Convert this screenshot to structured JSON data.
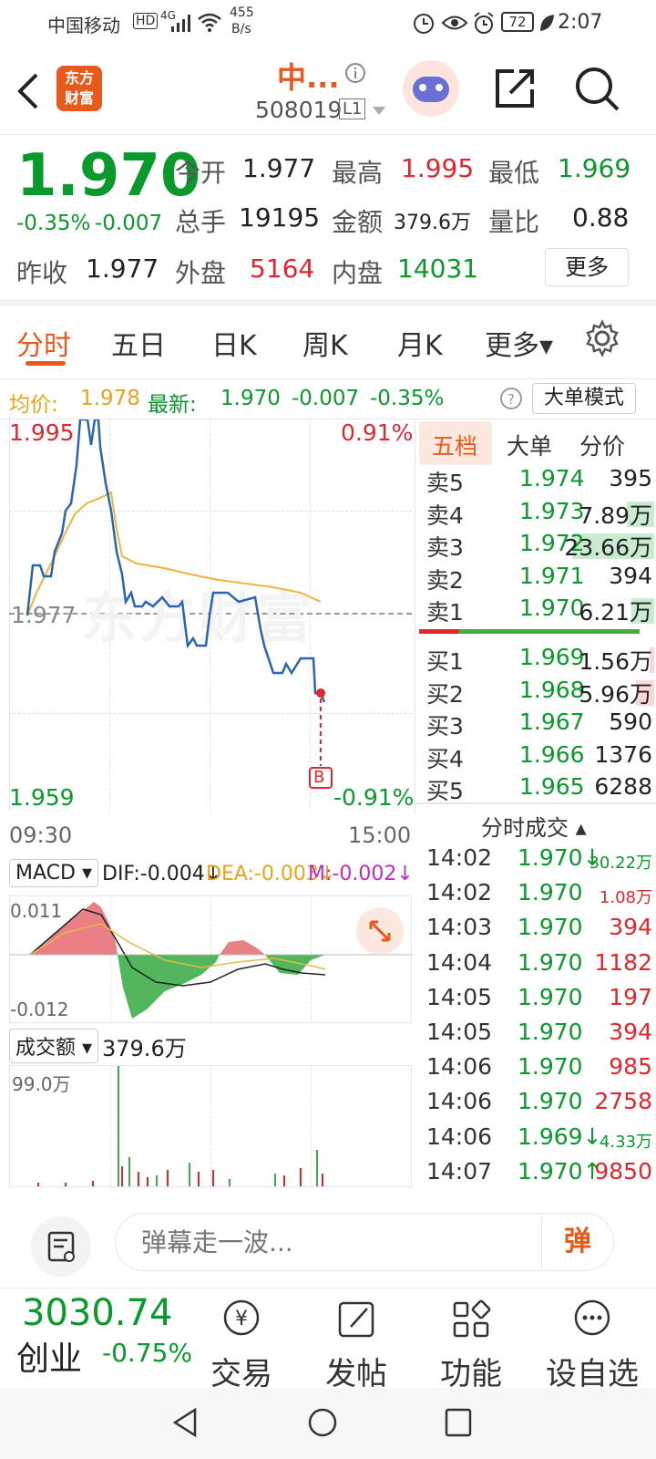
{
  "status_bar": {
    "carrier": "中国移动",
    "hd": "HD",
    "signal": "4G",
    "speed_value": "455",
    "speed_unit": "B/s",
    "battery": "72",
    "time": "2:07"
  },
  "header": {
    "stock_name": "中...",
    "stock_code": "508019",
    "level": "L1"
  },
  "quote": {
    "price": "1.970",
    "change_pct": "-0.35%",
    "change": "-0.007",
    "open_label": "今开",
    "open": "1.977",
    "high_label": "最高",
    "high": "1.995",
    "low_label": "最低",
    "low": "1.969",
    "volume_label": "总手",
    "volume": "19195",
    "amount_label": "金额",
    "amount": "379.6万",
    "ratio_label": "量比",
    "ratio": "0.88",
    "prev_close_label": "昨收",
    "prev_close": "1.977",
    "outer_label": "外盘",
    "outer": "5164",
    "inner_label": "内盘",
    "inner": "14031",
    "more_label": "更多"
  },
  "tabs": [
    {
      "label": "分时"
    },
    {
      "label": "五日"
    },
    {
      "label": "日K"
    },
    {
      "label": "周K"
    },
    {
      "label": "月K"
    },
    {
      "label": "更多▾"
    }
  ],
  "avg_line": {
    "avg_label": "均价:",
    "avg_value": "1.978",
    "latest_label": "最新:",
    "latest": "1.970",
    "change": "-0.007",
    "pct": "-0.35%",
    "big_order_label": "大单模式"
  },
  "chart": {
    "y_top": "1.995",
    "y_mid": "1.977",
    "y_bottom": "1.959",
    "pct_top": "0.91%",
    "pct_bottom": "-0.91%",
    "x_start": "09:30",
    "x_end": "15:00",
    "watermark": "东方财富",
    "marker": "B"
  },
  "macd": {
    "label": "MACD ▾",
    "dif": "DIF:-0.004↓",
    "dea": "DEA:-0.003↓",
    "m": "M:-0.002↓",
    "y_top": "0.011",
    "y_bottom": "-0.012"
  },
  "volume_panel": {
    "label": "成交额 ▾",
    "value": "379.6万",
    "y_top": "99.0万"
  },
  "orderbook": {
    "tabs": [
      "五档",
      "大单",
      "分价"
    ],
    "asks": [
      {
        "label": "卖5",
        "price": "1.974",
        "vol": "395",
        "bar": 0.0
      },
      {
        "label": "卖4",
        "price": "1.973",
        "vol": "7.89万",
        "bar": 0.12
      },
      {
        "label": "卖3",
        "price": "1.972",
        "vol": "23.66万",
        "bar": 0.36
      },
      {
        "label": "卖2",
        "price": "1.971",
        "vol": "394",
        "bar": 0.0
      },
      {
        "label": "卖1",
        "price": "1.970",
        "vol": "6.21万",
        "bar": 0.1
      }
    ],
    "bids": [
      {
        "label": "买1",
        "price": "1.969",
        "vol": "1.56万",
        "bar": 0.02
      },
      {
        "label": "买2",
        "price": "1.968",
        "vol": "5.96万",
        "bar": 0.08
      },
      {
        "label": "买3",
        "price": "1.967",
        "vol": "590",
        "bar": 0.0
      },
      {
        "label": "买4",
        "price": "1.966",
        "vol": "1376",
        "bar": 0.0
      },
      {
        "label": "买5",
        "price": "1.965",
        "vol": "6288",
        "bar": 0.0
      }
    ],
    "trades_title": "分时成交 ▴",
    "trades": [
      {
        "time": "14:02",
        "price": "1.970↓",
        "vol": "30.22万",
        "dir": "g",
        "small": true
      },
      {
        "time": "14:02",
        "price": "1.970",
        "vol": "1.08万",
        "dir": "r",
        "small": true
      },
      {
        "time": "14:03",
        "price": "1.970",
        "vol": "394",
        "dir": "r",
        "small": false
      },
      {
        "time": "14:04",
        "price": "1.970",
        "vol": "1182",
        "dir": "r",
        "small": false
      },
      {
        "time": "14:05",
        "price": "1.970",
        "vol": "197",
        "dir": "r",
        "small": false
      },
      {
        "time": "14:05",
        "price": "1.970",
        "vol": "394",
        "dir": "r",
        "small": false
      },
      {
        "time": "14:06",
        "price": "1.970",
        "vol": "985",
        "dir": "r",
        "small": false
      },
      {
        "time": "14:06",
        "price": "1.970",
        "vol": "2758",
        "dir": "r",
        "small": false
      },
      {
        "time": "14:06",
        "price": "1.969↓",
        "vol": "4.33万",
        "dir": "g",
        "small": true
      },
      {
        "time": "14:07",
        "price": "1.970↑",
        "vol": "9850",
        "dir": "r",
        "small": false
      }
    ]
  },
  "danmu": {
    "placeholder": "弹幕走一波...",
    "button": "弹"
  },
  "bottom_nav": {
    "index_value": "3030.74",
    "index_name": "创业",
    "index_change": "-0.75%",
    "items": [
      {
        "label": "交易"
      },
      {
        "label": "发帖"
      },
      {
        "label": "功能"
      },
      {
        "label": "设自选"
      }
    ]
  },
  "colors": {
    "up": "#e0262e",
    "down": "#0a9a2c",
    "accent": "#e8591c",
    "avg": "#f0b43c",
    "price_line": "#2a66b0"
  }
}
